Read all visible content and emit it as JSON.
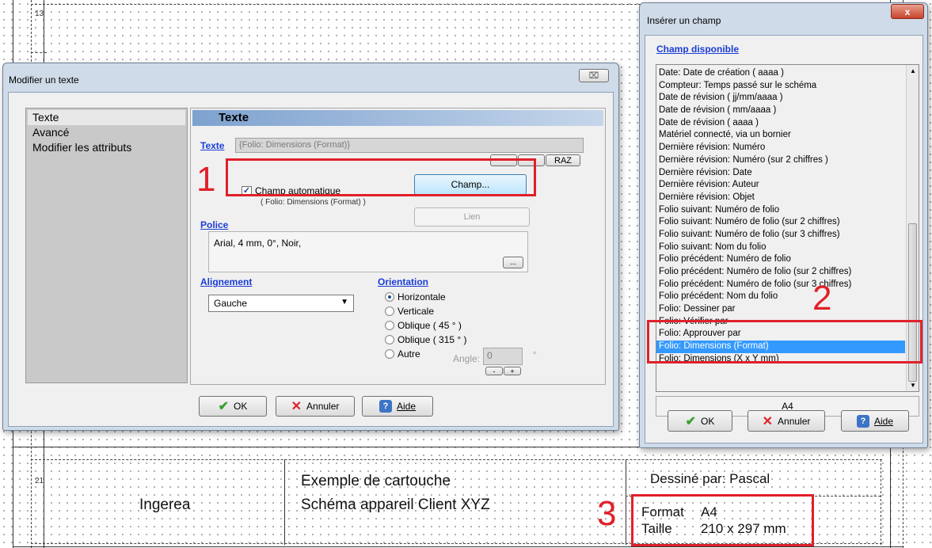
{
  "background": {
    "row_numbers": [
      "13",
      "21"
    ],
    "cartouche": {
      "company": "Ingerea",
      "title_line1": "Exemple de cartouche",
      "title_line2": "Schéma appareil Client XYZ",
      "drawn_by": "Dessiné par: Pascal",
      "format_label": "Format",
      "format_value": "A4",
      "size_label": "Taille",
      "size_value": "210 x 297 mm"
    }
  },
  "modifier_dialog": {
    "title": "Modifier un texte",
    "close_label": "⌧",
    "sidebar": [
      {
        "label": "Texte",
        "selected": true
      },
      {
        "label": "Avancé"
      },
      {
        "label": "Modifier les attributs"
      }
    ],
    "section_header": "Texte",
    "texte_link": "Texte",
    "texte_value": "{Folio: Dimensions (Format)}",
    "raz_label": "RAZ",
    "champ_auto_label": "Champ automatique",
    "champ_auto_checked": true,
    "champ_button": "Champ...",
    "champ_hint": "( Folio: Dimensions (Format) )",
    "police_link": "Police",
    "lien_button": "Lien",
    "police_value": "Arial, 4 mm, 0°, Noir,",
    "police_more": "...",
    "alignement_link": "Alignement",
    "alignement_value": "Gauche",
    "orientation_link": "Orientation",
    "orientations": [
      {
        "label": "Horizontale",
        "selected": true
      },
      {
        "label": "Verticale"
      },
      {
        "label": "Oblique ( 45 ° )"
      },
      {
        "label": "Oblique ( 315 ° )"
      },
      {
        "label": "Autre"
      }
    ],
    "angle_label": "Angle:",
    "angle_value": "0",
    "angle_unit": "°",
    "stepper_minus": "-",
    "stepper_plus": "+",
    "ok_label": "OK",
    "cancel_label": "Annuler",
    "help_label": "Aide"
  },
  "inserer_dialog": {
    "title": "Insérer un champ",
    "close_label": "x",
    "heading": "Champ disponible",
    "fields": [
      "Date: Date de création ( aaaa )",
      "Compteur: Temps passé sur le schéma",
      "Date de révision ( jj/mm/aaaa )",
      "Date de révision ( mm/aaaa )",
      "Date de révision ( aaaa )",
      "Matériel connecté, via un bornier",
      "Dernière révision: Numéro",
      "Dernière révision: Numéro (sur 2 chiffres )",
      "Dernière révision: Date",
      "Dernière révision: Auteur",
      "Dernière révision: Objet",
      "Folio suivant: Numéro de folio",
      "Folio suivant: Numéro de folio (sur 2 chiffres)",
      "Folio suivant: Numéro de folio (sur 3 chiffres)",
      "Folio suivant: Nom du folio",
      "Folio précédent: Numéro de folio",
      "Folio précédent: Numéro de folio (sur 2 chiffres)",
      "Folio précédent: Numéro de folio (sur 3 chiffres)",
      "Folio précédent: Nom du folio",
      "Folio: Dessiner par",
      "Folio: Vérifier par",
      "Folio: Approuver par",
      "Folio: Dimensions (Format)",
      "Folio: Dimensions (X x Y mm)"
    ],
    "selected_index": 22,
    "preview_value": "A4",
    "ok_label": "OK",
    "cancel_label": "Annuler",
    "help_label": "Aide"
  },
  "annotations": {
    "step1": "1",
    "step2": "2",
    "step3": "3",
    "color": "#e0202a"
  }
}
